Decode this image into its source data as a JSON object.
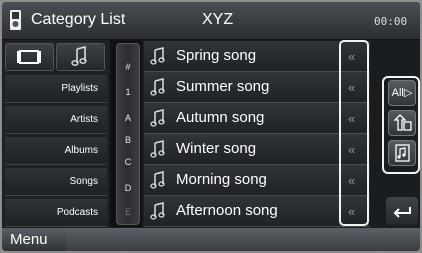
{
  "header": {
    "title": "Category List",
    "source": "XYZ",
    "clock": "00:00"
  },
  "sidebar": {
    "categories": [
      "Playlists",
      "Artists",
      "Albums",
      "Songs",
      "Podcasts"
    ]
  },
  "index": {
    "letters": [
      "#",
      "1",
      "A",
      "B",
      "C",
      "D",
      "E"
    ]
  },
  "songs": [
    "Spring song",
    "Summer song",
    "Autumn song",
    "Winter song",
    "Morning song",
    "Afternoon song"
  ],
  "right_panel": {
    "all_label": "All"
  },
  "footer": {
    "menu_label": "Menu"
  }
}
